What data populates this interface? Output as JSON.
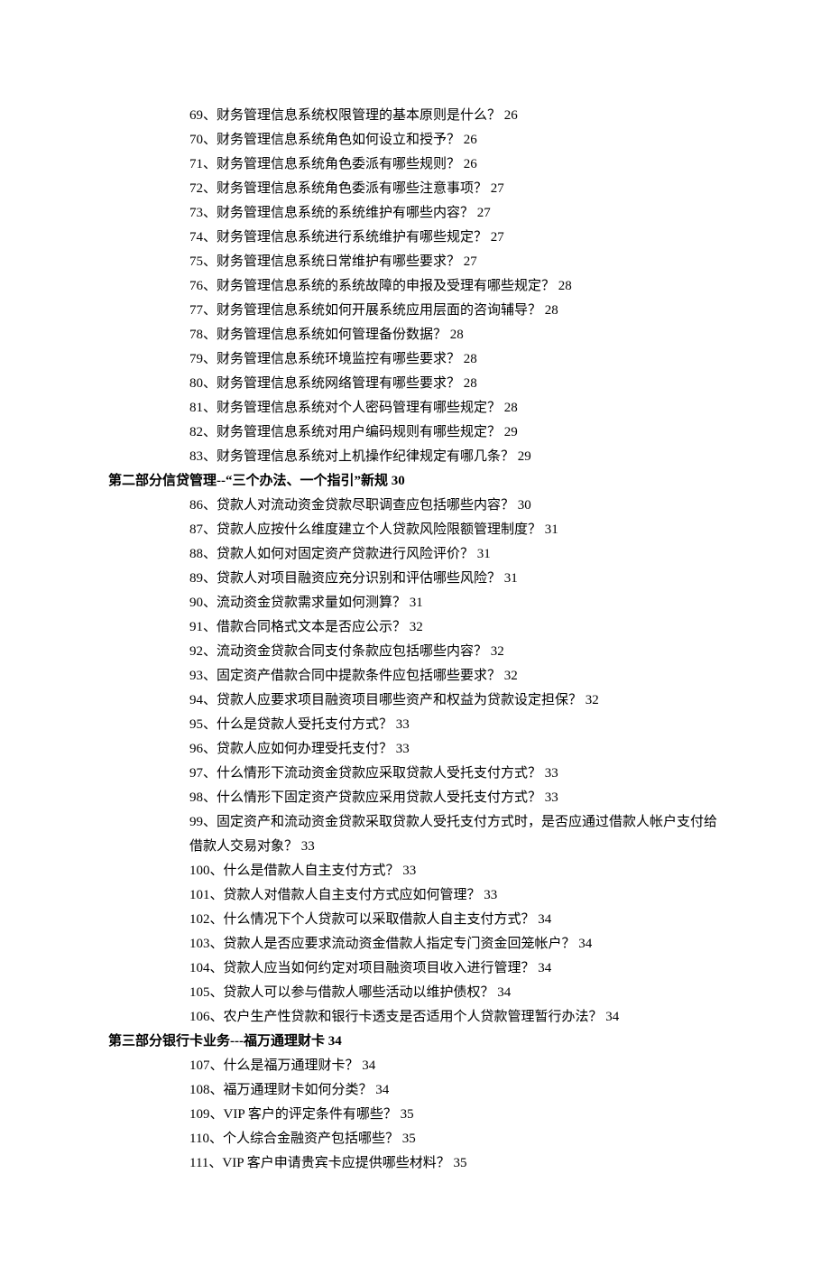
{
  "sections": [
    {
      "header": null,
      "items": [
        {
          "num": "69",
          "text": "财务管理信息系统权限管理的基本原则是什么？",
          "page": "26"
        },
        {
          "num": "70",
          "text": "财务管理信息系统角色如何设立和授予？",
          "page": "26"
        },
        {
          "num": "71",
          "text": "财务管理信息系统角色委派有哪些规则？",
          "page": "26"
        },
        {
          "num": "72",
          "text": "财务管理信息系统角色委派有哪些注意事项？",
          "page": "27"
        },
        {
          "num": "73",
          "text": "财务管理信息系统的系统维护有哪些内容？",
          "page": "27"
        },
        {
          "num": "74",
          "text": "财务管理信息系统进行系统维护有哪些规定？",
          "page": "27"
        },
        {
          "num": "75",
          "text": "财务管理信息系统日常维护有哪些要求？",
          "page": "27"
        },
        {
          "num": "76",
          "text": "财务管理信息系统的系统故障的申报及受理有哪些规定？",
          "page": "28"
        },
        {
          "num": "77",
          "text": "财务管理信息系统如何开展系统应用层面的咨询辅导？",
          "page": "28"
        },
        {
          "num": "78",
          "text": "财务管理信息系统如何管理备份数据？",
          "page": "28"
        },
        {
          "num": "79",
          "text": "财务管理信息系统环境监控有哪些要求？",
          "page": "28"
        },
        {
          "num": "80",
          "text": "财务管理信息系统网络管理有哪些要求？",
          "page": "28"
        },
        {
          "num": "81",
          "text": "财务管理信息系统对个人密码管理有哪些规定？",
          "page": "28"
        },
        {
          "num": "82",
          "text": "财务管理信息系统对用户编码规则有哪些规定？",
          "page": "29"
        },
        {
          "num": "83",
          "text": "财务管理信息系统对上机操作纪律规定有哪几条？",
          "page": "29"
        }
      ]
    },
    {
      "header": {
        "text": "第二部分信贷管理--“三个办法、一个指引”新规",
        "page": "30"
      },
      "items": [
        {
          "num": "86",
          "text": "贷款人对流动资金贷款尽职调查应包括哪些内容？",
          "page": "30"
        },
        {
          "num": "87",
          "text": "贷款人应按什么维度建立个人贷款风险限额管理制度？",
          "page": "31"
        },
        {
          "num": "88",
          "text": "贷款人如何对固定资产贷款进行风险评价？",
          "page": "31"
        },
        {
          "num": "89",
          "text": "贷款人对项目融资应充分识别和评估哪些风险？",
          "page": "31"
        },
        {
          "num": "90",
          "text": "流动资金贷款需求量如何测算？",
          "page": "31"
        },
        {
          "num": "91",
          "text": "借款合同格式文本是否应公示？",
          "page": "32"
        },
        {
          "num": "92",
          "text": "流动资金贷款合同支付条款应包括哪些内容？",
          "page": "32"
        },
        {
          "num": "93",
          "text": "固定资产借款合同中提款条件应包括哪些要求？",
          "page": "32"
        },
        {
          "num": "94",
          "text": "贷款人应要求项目融资项目哪些资产和权益为贷款设定担保？",
          "page": "32"
        },
        {
          "num": "95",
          "text": "什么是贷款人受托支付方式？",
          "page": "33"
        },
        {
          "num": "96",
          "text": "贷款人应如何办理受托支付？",
          "page": "33"
        },
        {
          "num": "97",
          "text": "什么情形下流动资金贷款应采取贷款人受托支付方式？",
          "page": "33"
        },
        {
          "num": "98",
          "text": "什么情形下固定资产贷款应采用贷款人受托支付方式？",
          "page": "33"
        },
        {
          "num": "99",
          "text": "固定资产和流动资金贷款采取贷款人受托支付方式时，是否应通过借款人帐户支付给借款人交易对象？",
          "page": "33"
        },
        {
          "num": "100",
          "text": "什么是借款人自主支付方式？",
          "page": "33"
        },
        {
          "num": "101",
          "text": "贷款人对借款人自主支付方式应如何管理？",
          "page": "33"
        },
        {
          "num": "102",
          "text": "什么情况下个人贷款可以采取借款人自主支付方式？",
          "page": "34"
        },
        {
          "num": "103",
          "text": "贷款人是否应要求流动资金借款人指定专门资金回笼帐户？",
          "page": "34"
        },
        {
          "num": "104",
          "text": "贷款人应当如何约定对项目融资项目收入进行管理？",
          "page": "34"
        },
        {
          "num": "105",
          "text": "贷款人可以参与借款人哪些活动以维护债权？",
          "page": "34"
        },
        {
          "num": "106",
          "text": "农户生产性贷款和银行卡透支是否适用个人贷款管理暂行办法？",
          "page": "34"
        }
      ]
    },
    {
      "header": {
        "text": "第三部分银行卡业务---福万通理财卡",
        "page": "34"
      },
      "items": [
        {
          "num": "107",
          "text": "什么是福万通理财卡？",
          "page": "34"
        },
        {
          "num": "108",
          "text": "福万通理财卡如何分类？",
          "page": "34"
        },
        {
          "num": "109",
          "text": "VIP 客户的评定条件有哪些？",
          "page": "35"
        },
        {
          "num": "110",
          "text": "个人综合金融资产包括哪些？",
          "page": "35"
        },
        {
          "num": "111",
          "text": "VIP 客户申请贵宾卡应提供哪些材料？",
          "page": "35"
        }
      ]
    }
  ]
}
